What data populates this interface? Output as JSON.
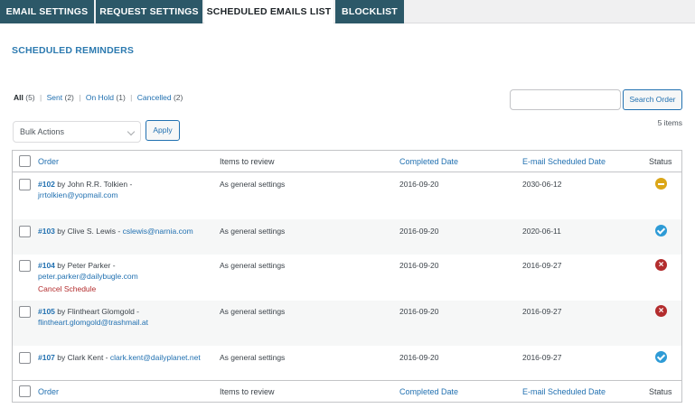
{
  "tabs": [
    {
      "label": "EMAIL SETTINGS",
      "active": false
    },
    {
      "label": "REQUEST SETTINGS",
      "active": false
    },
    {
      "label": "SCHEDULED EMAILS LIST",
      "active": true
    },
    {
      "label": "BLOCKLIST",
      "active": false
    }
  ],
  "page_title": "SCHEDULED REMINDERS",
  "filters": {
    "all": {
      "label": "All",
      "count": "(5)"
    },
    "sent": {
      "label": "Sent",
      "count": "(2)"
    },
    "on_hold": {
      "label": "On Hold",
      "count": "(1)"
    },
    "cancelled": {
      "label": "Cancelled",
      "count": "(2)"
    },
    "separator": "|"
  },
  "search": {
    "value": "",
    "button_label": "Search Order"
  },
  "items_count": "5 items",
  "bulk": {
    "selected": "Bulk Actions",
    "apply_label": "Apply"
  },
  "columns": {
    "order": "Order",
    "items": "Items to review",
    "completed": "Completed Date",
    "scheduled": "E-mail Scheduled Date",
    "status": "Status"
  },
  "rows": [
    {
      "num": "#102",
      "by": "by John R.R. Tolkien -",
      "email": "jrrtolkien@yopmail.com",
      "items": "As general settings",
      "completed": "2016-09-20",
      "scheduled": "2030-06-12",
      "status": "on-hold",
      "action": ""
    },
    {
      "num": "#103",
      "by": "by Clive S. Lewis -",
      "email": "cslewis@narnia.com",
      "items": "As general settings",
      "completed": "2016-09-20",
      "scheduled": "2020-06-11",
      "status": "sent",
      "action": ""
    },
    {
      "num": "#104",
      "by": "by Peter Parker -",
      "email": "peter.parker@dailybugle.com",
      "items": "As general settings",
      "completed": "2016-09-20",
      "scheduled": "2016-09-27",
      "status": "cancelled",
      "action": "Cancel Schedule"
    },
    {
      "num": "#105",
      "by": "by Flintheart Glomgold -",
      "email": "flintheart.glomgold@trashmail.at",
      "items": "As general settings",
      "completed": "2016-09-20",
      "scheduled": "2016-09-27",
      "status": "cancelled",
      "action": ""
    },
    {
      "num": "#107",
      "by": "by Clark Kent -",
      "email": "clark.kent@dailyplanet.net",
      "items": "As general settings",
      "completed": "2016-09-20",
      "scheduled": "2016-09-27",
      "status": "sent",
      "action": ""
    }
  ],
  "colors": {
    "tab_bg": "#2c5868",
    "accent": "#2271b1",
    "heading": "#2c7ab0",
    "on_hold": "#dba617",
    "sent": "#2e9bd6",
    "cancelled": "#b32d2e"
  }
}
